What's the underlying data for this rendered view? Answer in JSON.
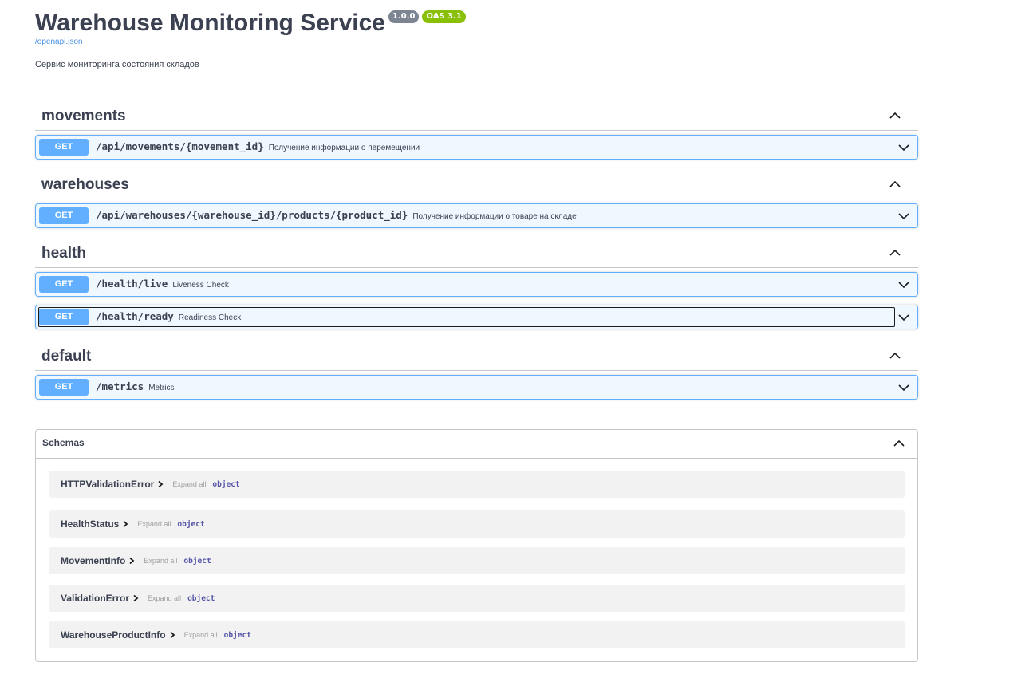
{
  "info": {
    "title": "Warehouse Monitoring Service",
    "version": "1.0.0",
    "oas": "OAS 3.1",
    "spec_link": "/openapi.json",
    "description": "Сервис мониторинга состояния складов"
  },
  "tags": [
    {
      "name": "movements",
      "operations": [
        {
          "method": "GET",
          "path": "/api/movements/{movement_id}",
          "summary": "Получение информации о перемещении"
        }
      ]
    },
    {
      "name": "warehouses",
      "operations": [
        {
          "method": "GET",
          "path": "/api/warehouses/{warehouse_id}/products/{product_id}",
          "summary": "Получение информации о товаре на складе"
        }
      ]
    },
    {
      "name": "health",
      "operations": [
        {
          "method": "GET",
          "path": "/health/live",
          "summary": "Liveness Check"
        },
        {
          "method": "GET",
          "path": "/health/ready",
          "summary": "Readiness Check"
        }
      ]
    },
    {
      "name": "default",
      "operations": [
        {
          "method": "GET",
          "path": "/metrics",
          "summary": "Metrics"
        }
      ]
    }
  ],
  "schemas": {
    "title": "Schemas",
    "models": [
      {
        "name": "HTTPValidationError",
        "expand": "Expand all",
        "type": "object"
      },
      {
        "name": "HealthStatus",
        "expand": "Expand all",
        "type": "object"
      },
      {
        "name": "MovementInfo",
        "expand": "Expand all",
        "type": "object"
      },
      {
        "name": "ValidationError",
        "expand": "Expand all",
        "type": "object"
      },
      {
        "name": "WarehouseProductInfo",
        "expand": "Expand all",
        "type": "object"
      }
    ]
  },
  "colors": {
    "get": "#61affe",
    "text": "#3b4151",
    "link": "#4990e2",
    "version_badge": "#7d8492",
    "oas_badge": "#89bf04"
  }
}
